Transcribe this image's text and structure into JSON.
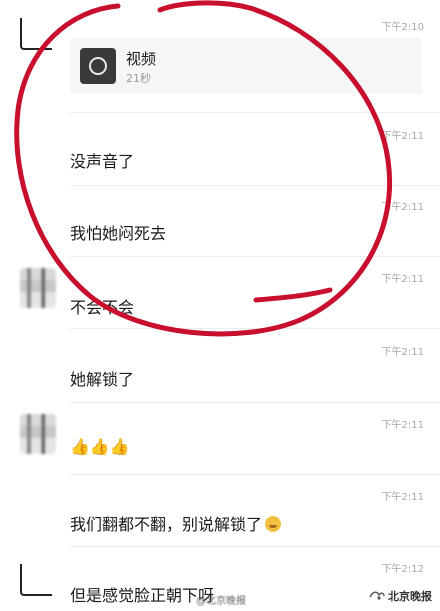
{
  "video": {
    "title": "视频",
    "duration": "21秒"
  },
  "messages": [
    {
      "time": "下午2:10"
    },
    {
      "time": "下午2:11",
      "text": "没声音了"
    },
    {
      "time": "下午2:11",
      "text": "我怕她闷死去"
    },
    {
      "time": "下午2:11",
      "text": "不会不会"
    },
    {
      "time": "下午2:11",
      "text": "她解锁了"
    },
    {
      "time": "下午2:11",
      "text": "👍👍👍"
    },
    {
      "time": "下午2:11",
      "text": "我们翻都不翻，别说解锁了"
    },
    {
      "time": "下午2:12",
      "text": "但是感觉脸正朝下呀"
    }
  ],
  "watermark": {
    "left": "@北京晚报",
    "right": "北京晚报"
  },
  "colors": {
    "annotation_circle": "#c8102e",
    "timestamp": "#a8a8a8",
    "divider": "#ececec"
  }
}
